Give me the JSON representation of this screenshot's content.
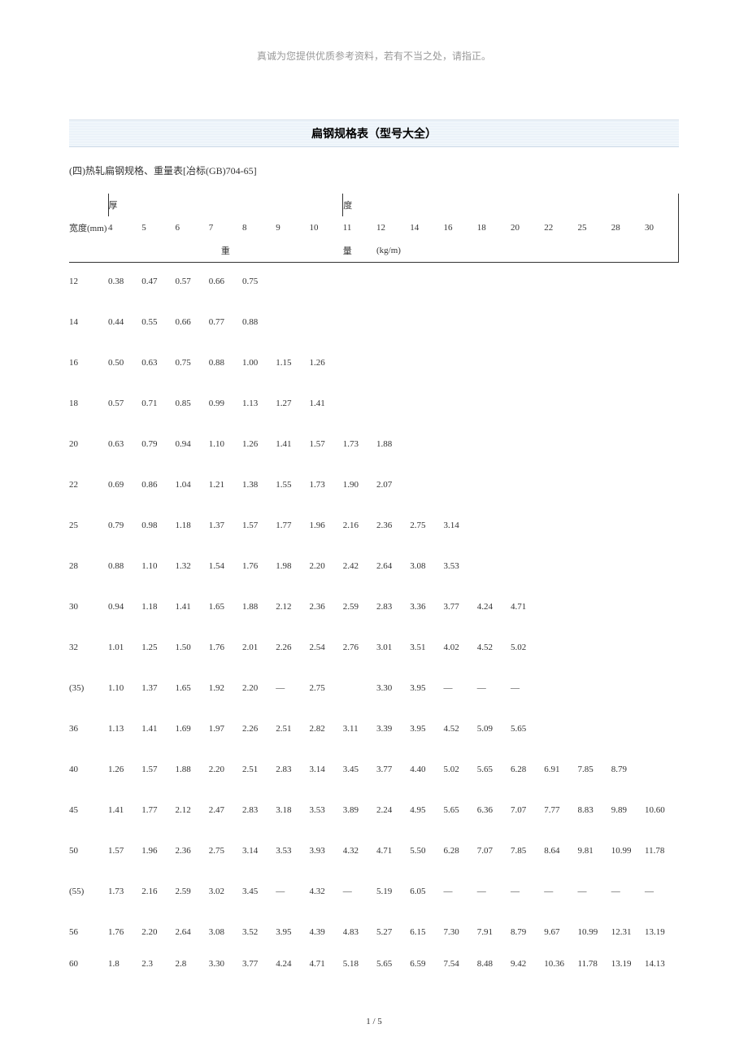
{
  "header_note": "真诚为您提供优质参考资料，若有不当之处，请指正。",
  "title": "扁钢规格表（型号大全）",
  "subtitle": "(四)热轧扁钢规格、重量表[冶标(GB)704-65]",
  "table": {
    "thick_label": "厚",
    "du_label": "度",
    "width_label": "宽度(mm)",
    "weight_label": "重",
    "liang_label": "量",
    "unit_label": "(kg/m)",
    "thicknesses": [
      "4",
      "5",
      "6",
      "7",
      "8",
      "9",
      "10",
      "11",
      "12",
      "14",
      "16",
      "18",
      "20",
      "22",
      "25",
      "28",
      "30"
    ],
    "rows": [
      {
        "w": "12",
        "v": [
          "0.38",
          "0.47",
          "0.57",
          "0.66",
          "0.75",
          "",
          "",
          "",
          "",
          "",
          "",
          "",
          "",
          "",
          "",
          "",
          ""
        ]
      },
      {
        "w": "14",
        "v": [
          "0.44",
          "0.55",
          "0.66",
          "0.77",
          "0.88",
          "",
          "",
          "",
          "",
          "",
          "",
          "",
          "",
          "",
          "",
          "",
          ""
        ]
      },
      {
        "w": "16",
        "v": [
          "0.50",
          "0.63",
          "0.75",
          "0.88",
          "1.00",
          "1.15",
          "1.26",
          "",
          "",
          "",
          "",
          "",
          "",
          "",
          "",
          "",
          ""
        ]
      },
      {
        "w": "18",
        "v": [
          "0.57",
          "0.71",
          "0.85",
          "0.99",
          "1.13",
          "1.27",
          "1.41",
          "",
          "",
          "",
          "",
          "",
          "",
          "",
          "",
          "",
          ""
        ]
      },
      {
        "w": "20",
        "v": [
          "0.63",
          "0.79",
          "0.94",
          "1.10",
          "1.26",
          "1.41",
          "1.57",
          "1.73",
          "1.88",
          "",
          "",
          "",
          "",
          "",
          "",
          "",
          ""
        ]
      },
      {
        "w": "22",
        "v": [
          "0.69",
          "0.86",
          "1.04",
          "1.21",
          "1.38",
          "1.55",
          "1.73",
          "1.90",
          "2.07",
          "",
          "",
          "",
          "",
          "",
          "",
          "",
          ""
        ]
      },
      {
        "w": "25",
        "v": [
          "0.79",
          "0.98",
          "1.18",
          "1.37",
          "1.57",
          "1.77",
          "1.96",
          "2.16",
          "2.36",
          "2.75",
          "3.14",
          "",
          "",
          "",
          "",
          "",
          ""
        ]
      },
      {
        "w": "28",
        "v": [
          "0.88",
          "1.10",
          "1.32",
          "1.54",
          "1.76",
          "1.98",
          "2.20",
          "2.42",
          "2.64",
          "3.08",
          "3.53",
          "",
          "",
          "",
          "",
          "",
          ""
        ]
      },
      {
        "w": "30",
        "v": [
          "0.94",
          "1.18",
          "1.41",
          "1.65",
          "1.88",
          "2.12",
          "2.36",
          "2.59",
          "2.83",
          "3.36",
          "3.77",
          "4.24",
          "4.71",
          "",
          "",
          "",
          ""
        ]
      },
      {
        "w": "32",
        "v": [
          "1.01",
          "1.25",
          "1.50",
          "1.76",
          "2.01",
          "2.26",
          "2.54",
          "2.76",
          "3.01",
          "3.51",
          "4.02",
          "4.52",
          "5.02",
          "",
          "",
          "",
          ""
        ]
      },
      {
        "w": "(35)",
        "v": [
          "1.10",
          "1.37",
          "1.65",
          "1.92",
          "2.20",
          "—",
          "2.75",
          "",
          "3.30",
          "3.95",
          "—",
          "—",
          "—",
          "",
          "",
          "",
          ""
        ]
      },
      {
        "w": "36",
        "v": [
          "1.13",
          "1.41",
          "1.69",
          "1.97",
          "2.26",
          "2.51",
          "2.82",
          "3.11",
          "3.39",
          "3.95",
          "4.52",
          "5.09",
          "5.65",
          "",
          "",
          "",
          ""
        ]
      },
      {
        "w": "40",
        "v": [
          "1.26",
          "1.57",
          "1.88",
          "2.20",
          "2.51",
          "2.83",
          "3.14",
          "3.45",
          "3.77",
          "4.40",
          "5.02",
          "5.65",
          "6.28",
          "6.91",
          "7.85",
          "8.79",
          ""
        ]
      },
      {
        "w": "45",
        "v": [
          "1.41",
          "1.77",
          "2.12",
          "2.47",
          "2.83",
          "3.18",
          "3.53",
          "3.89",
          "2.24",
          "4.95",
          "5.65",
          "6.36",
          "7.07",
          "7.77",
          "8.83",
          "9.89",
          "10.60"
        ]
      },
      {
        "w": "50",
        "v": [
          "1.57",
          "1.96",
          "2.36",
          "2.75",
          "3.14",
          "3.53",
          "3.93",
          "4.32",
          "4.71",
          "5.50",
          "6.28",
          "7.07",
          "7.85",
          "8.64",
          "9.81",
          "10.99",
          "11.78"
        ]
      },
      {
        "w": "(55)",
        "v": [
          "1.73",
          "2.16",
          "2.59",
          "3.02",
          "3.45",
          "—",
          "4.32",
          "—",
          "5.19",
          "6.05",
          "—",
          "—",
          "—",
          "—",
          "—",
          "—",
          "—"
        ]
      },
      {
        "w": "56",
        "v": [
          "1.76",
          "2.20",
          "2.64",
          "3.08",
          "3.52",
          "3.95",
          "4.39",
          "4.83",
          "5.27",
          "6.15",
          "7.30",
          "7.91",
          "8.79",
          "9.67",
          "10.99",
          "12.31",
          "13.19"
        ]
      },
      {
        "w": "60",
        "v": [
          "1.8",
          "2.3",
          "2.8",
          "3.30",
          "3.77",
          "4.24",
          "4.71",
          "5.18",
          "5.65",
          "6.59",
          "7.54",
          "8.48",
          "9.42",
          "10.36",
          "11.78",
          "13.19",
          "14.13"
        ]
      }
    ]
  },
  "page_num": "1 / 5"
}
